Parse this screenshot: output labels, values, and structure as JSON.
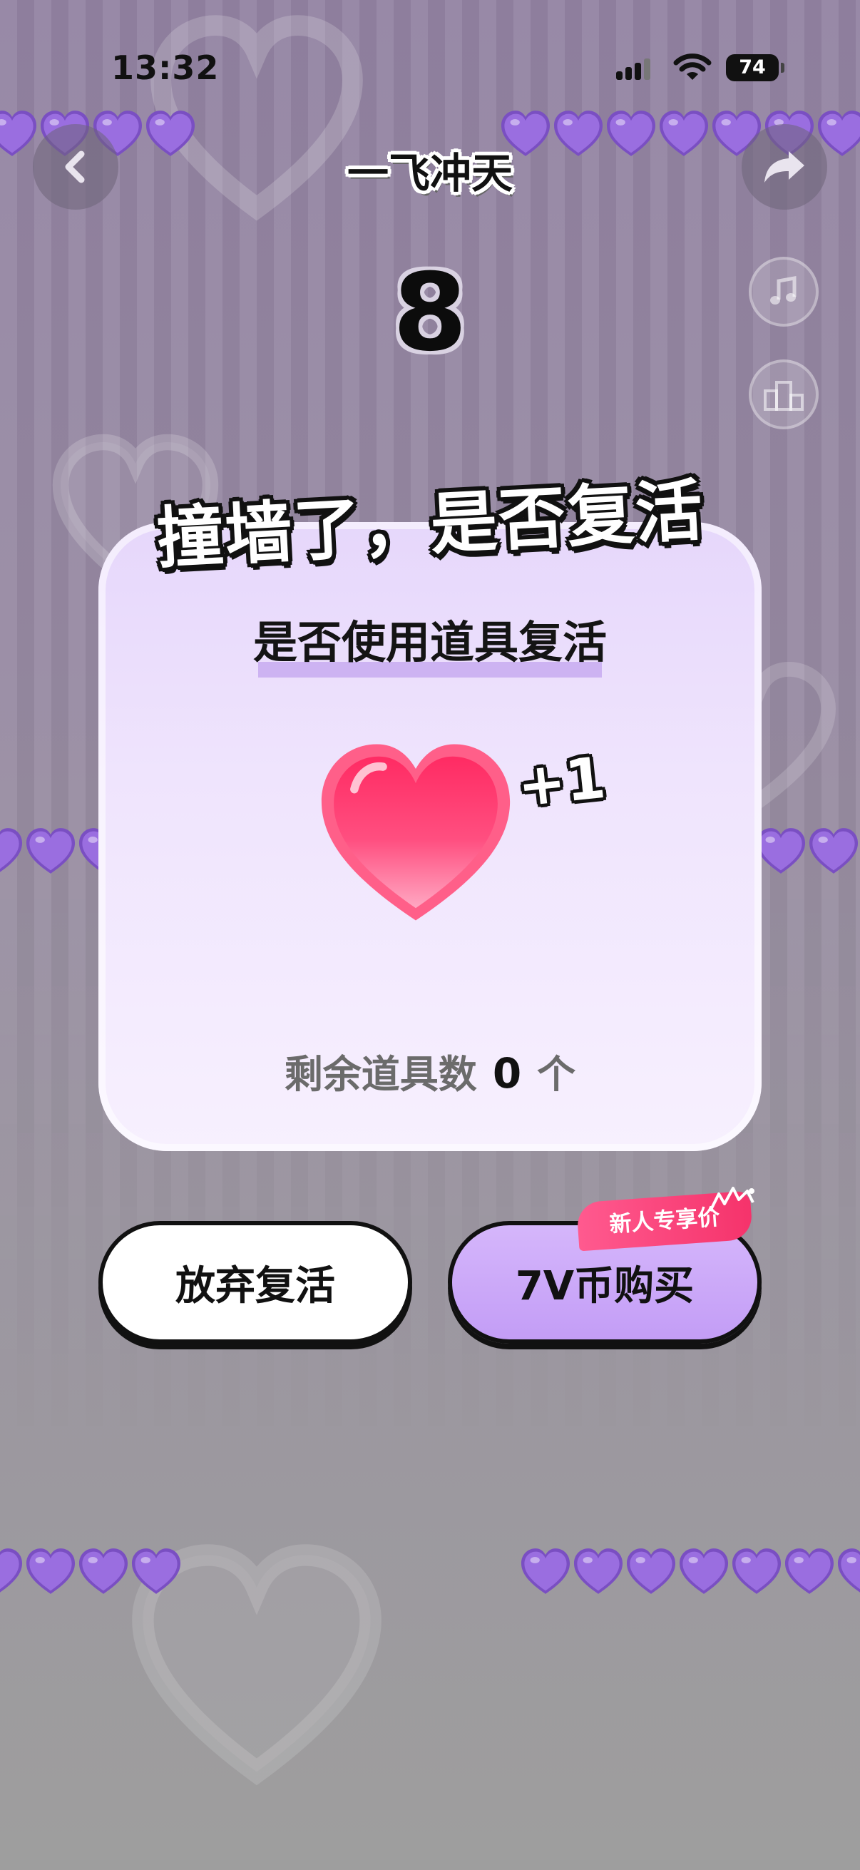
{
  "status_bar": {
    "time": "13:32",
    "battery": "74"
  },
  "nav": {
    "title": "一飞冲天",
    "back_icon": "chevron-left-icon",
    "share_icon": "share-arrow-icon"
  },
  "score": "8",
  "side_buttons": [
    {
      "icon": "music-note-icon"
    },
    {
      "icon": "podium-icon"
    }
  ],
  "dialog": {
    "banner": "撞墙了，是否复活",
    "subtitle": "是否使用道具复活",
    "reward_text": "+1",
    "remaining_label": "剩余道具数",
    "remaining_count": "0",
    "remaining_unit": "个"
  },
  "buttons": {
    "give_up": "放弃复活",
    "buy": "7V币购买",
    "promo_badge": "新人专享价"
  },
  "colors": {
    "accent_purple": "#c39df6",
    "heart_pink": "#ff3f73",
    "promo_pink": "#f5336b",
    "background": "#9383a3"
  }
}
